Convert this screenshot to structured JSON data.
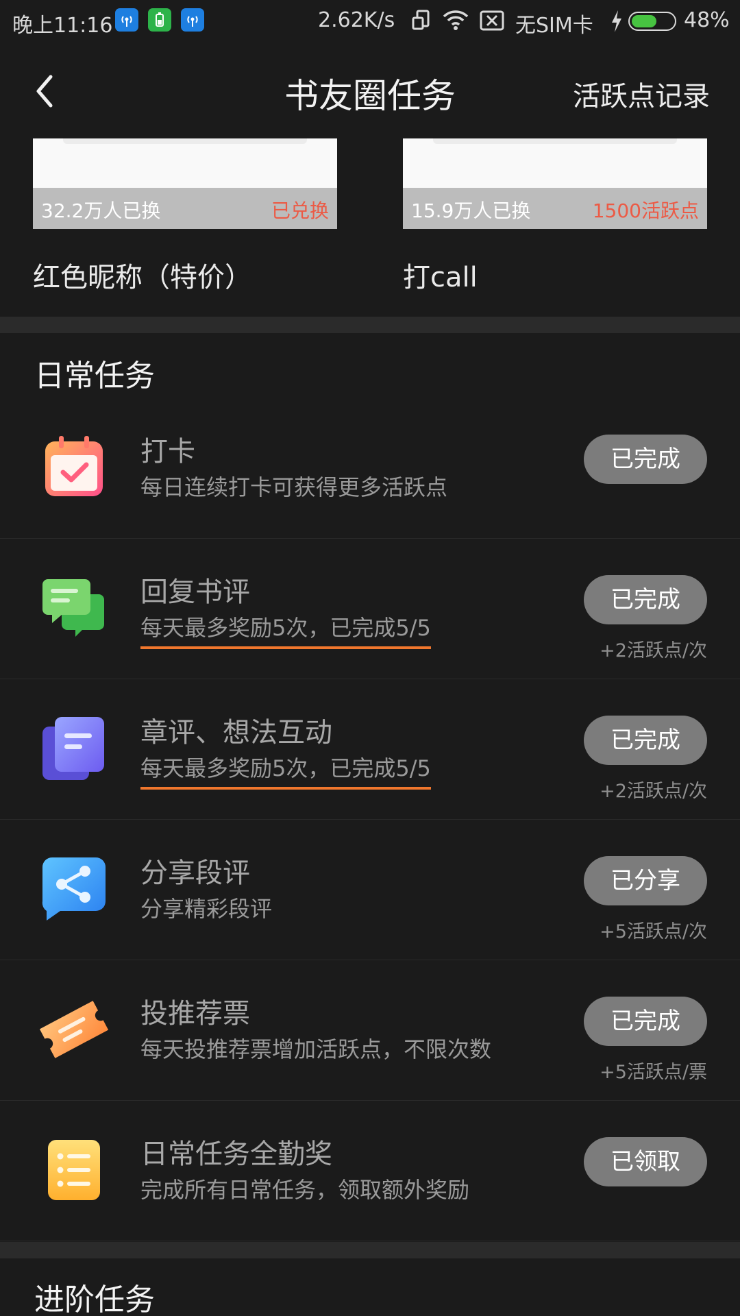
{
  "status_bar": {
    "time": "晚上11:16",
    "network_speed": "2.62K/s",
    "sim_status": "无SIM卡",
    "battery_level_percent": 48,
    "battery_text": "48%"
  },
  "nav": {
    "title": "书友圈任务",
    "action": "活跃点记录"
  },
  "rewards": [
    {
      "count": "32.2万人已换",
      "status": "已兑换",
      "name": "红色昵称（特价）"
    },
    {
      "count": "15.9万人已换",
      "status": "1500活跃点",
      "name": "打call"
    }
  ],
  "daily": {
    "title": "日常任务",
    "tasks": [
      {
        "icon": "calendar-check-icon",
        "title": "打卡",
        "desc": "每日连续打卡可获得更多活跃点",
        "button": "已完成",
        "reward": ""
      },
      {
        "icon": "chat-bubbles-icon",
        "title": "回复书评",
        "desc": "每天最多奖励5次，已完成5/5",
        "button": "已完成",
        "reward": "+2活跃点/次"
      },
      {
        "icon": "document-icon",
        "title": "章评、想法互动",
        "desc": "每天最多奖励5次，已完成5/5",
        "button": "已完成",
        "reward": "+2活跃点/次"
      },
      {
        "icon": "share-icon",
        "title": "分享段评",
        "desc": "分享精彩段评",
        "button": "已分享",
        "reward": "+5活跃点/次"
      },
      {
        "icon": "ticket-icon",
        "title": "投推荐票",
        "desc": "每天投推荐票增加活跃点，不限次数",
        "button": "已完成",
        "reward": "+5活跃点/票"
      },
      {
        "icon": "checklist-icon",
        "title": "日常任务全勤奖",
        "desc": "完成所有日常任务，领取额外奖励",
        "button": "已领取",
        "reward": ""
      }
    ]
  },
  "advanced": {
    "title": "进阶任务"
  },
  "colors": {
    "background": "#1b1b1b",
    "accent_red": "#ec5a45",
    "underline_orange": "#f0772d",
    "button_gray": "#7c7c7c"
  }
}
